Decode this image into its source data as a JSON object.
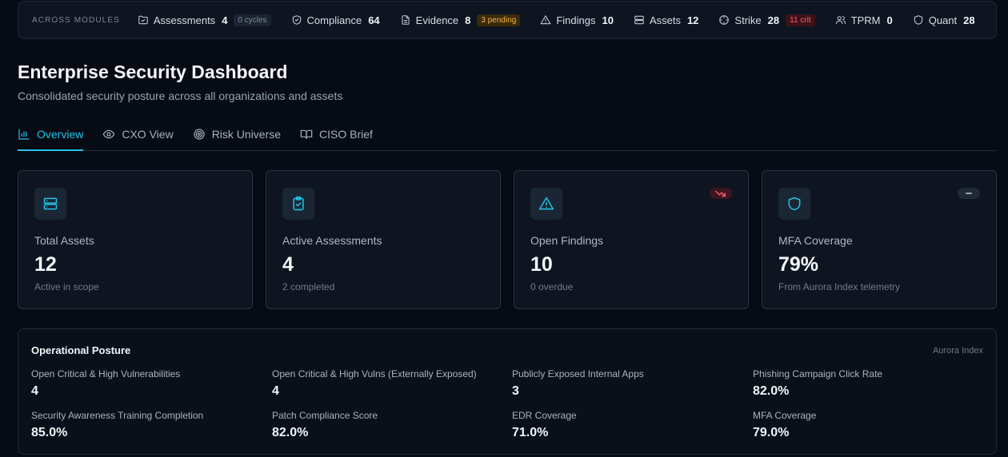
{
  "modules": {
    "label": "ACROSS MODULES",
    "items": [
      {
        "name": "Assessments",
        "count": "4",
        "chip": "0 cycles",
        "chip_style": "muted",
        "icon": "folder-check-icon"
      },
      {
        "name": "Compliance",
        "count": "64",
        "chip": "",
        "icon": "shield-check-icon"
      },
      {
        "name": "Evidence",
        "count": "8",
        "chip": "3 pending",
        "chip_style": "amber",
        "icon": "file-text-icon"
      },
      {
        "name": "Findings",
        "count": "10",
        "chip": "",
        "icon": "alert-triangle-icon"
      },
      {
        "name": "Assets",
        "count": "12",
        "chip": "",
        "icon": "server-icon"
      },
      {
        "name": "Strike",
        "count": "28",
        "chip": "11 crit",
        "chip_style": "red",
        "icon": "crosshair-icon"
      },
      {
        "name": "TPRM",
        "count": "0",
        "chip": "",
        "icon": "users-icon"
      },
      {
        "name": "Quant",
        "count": "28",
        "chip": "",
        "icon": "shield-icon"
      }
    ]
  },
  "header": {
    "title": "Enterprise Security Dashboard",
    "subtitle": "Consolidated security posture across all organizations and assets"
  },
  "tabs": [
    {
      "label": "Overview",
      "icon": "bar-chart-icon",
      "active": true
    },
    {
      "label": "CXO View",
      "icon": "eye-icon",
      "active": false
    },
    {
      "label": "Risk Universe",
      "icon": "target-icon",
      "active": false
    },
    {
      "label": "CISO Brief",
      "icon": "book-open-icon",
      "active": false
    }
  ],
  "cards": [
    {
      "label": "Total Assets",
      "value": "12",
      "sub": "Active in scope",
      "icon": "server-icon",
      "trend": ""
    },
    {
      "label": "Active Assessments",
      "value": "4",
      "sub": "2 completed",
      "icon": "clipboard-check-icon",
      "trend": ""
    },
    {
      "label": "Open Findings",
      "value": "10",
      "sub": "0 overdue",
      "icon": "alert-triangle-icon",
      "trend": "down"
    },
    {
      "label": "MFA Coverage",
      "value": "79%",
      "sub": "From Aurora Index telemetry",
      "icon": "shield-icon",
      "trend": "flat"
    }
  ],
  "posture": {
    "title": "Operational Posture",
    "source": "Aurora Index",
    "metrics": [
      {
        "label": "Open Critical & High Vulnerabilities",
        "value": "4"
      },
      {
        "label": "Open Critical & High Vulns (Externally Exposed)",
        "value": "4"
      },
      {
        "label": "Publicly Exposed Internal Apps",
        "value": "3"
      },
      {
        "label": "Phishing Campaign Click Rate",
        "value": "82.0%"
      },
      {
        "label": "Security Awareness Training Completion",
        "value": "85.0%"
      },
      {
        "label": "Patch Compliance Score",
        "value": "82.0%"
      },
      {
        "label": "EDR Coverage",
        "value": "71.0%"
      },
      {
        "label": "MFA Coverage",
        "value": "79.0%"
      }
    ]
  },
  "colors": {
    "background": "#070b14",
    "panel": "#0e1520",
    "accent": "#22c3e6",
    "warning": "#f2b544",
    "critical": "#ff5b6b"
  }
}
